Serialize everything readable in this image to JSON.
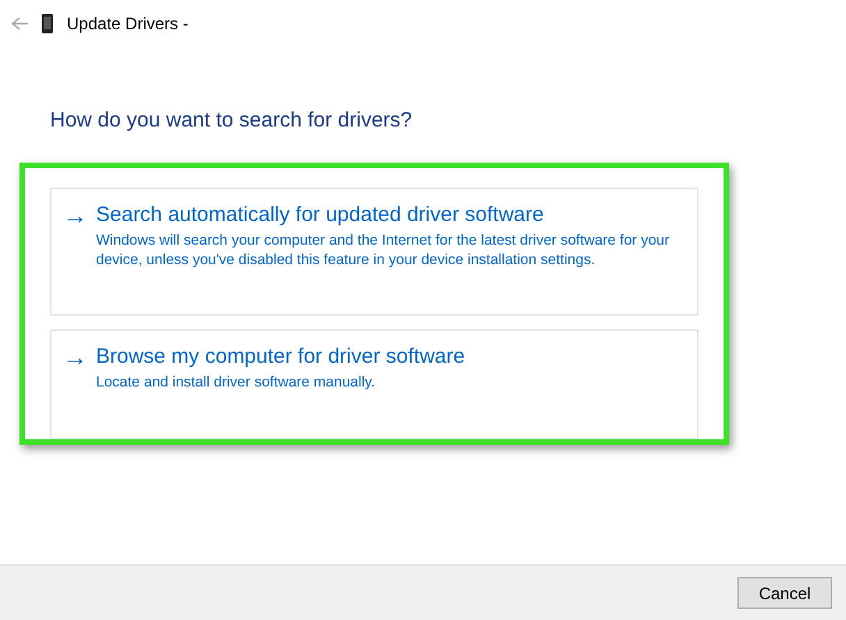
{
  "window": {
    "title": "Update Drivers - "
  },
  "heading": "How do you want to search for drivers?",
  "options": [
    {
      "arrow": "→",
      "title": "Search automatically for updated driver software",
      "description": "Windows will search your computer and the Internet for the latest driver software for your device, unless you've disabled this feature in your device installation settings."
    },
    {
      "arrow": "→",
      "title": "Browse my computer for driver software",
      "description": "Locate and install driver software manually."
    }
  ],
  "buttons": [
    "Cancel"
  ]
}
